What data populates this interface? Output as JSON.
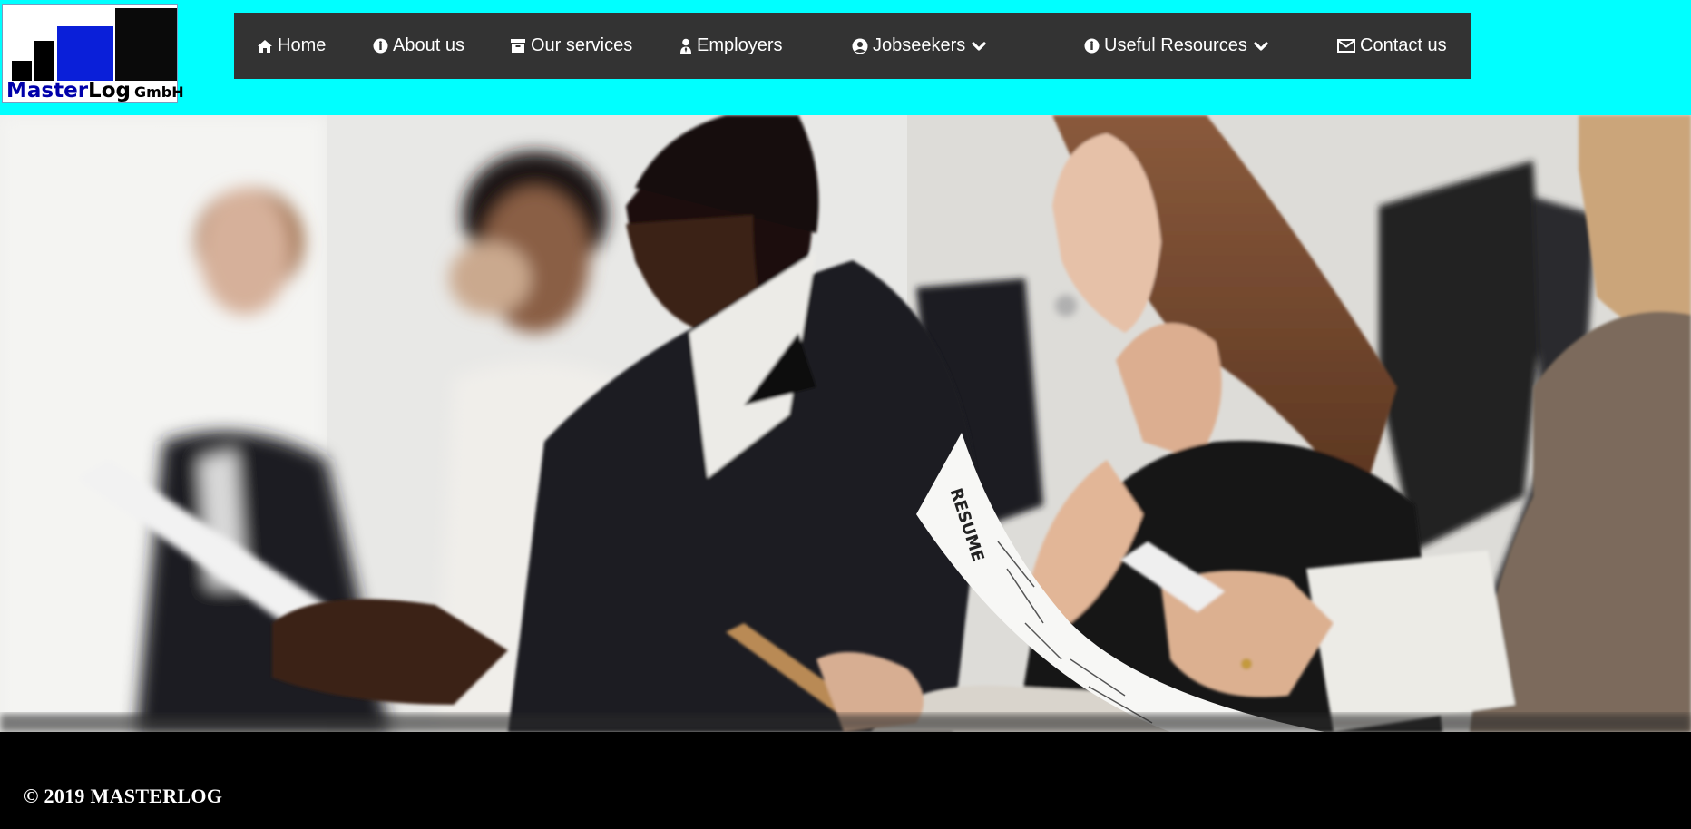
{
  "brand": {
    "name_part1": "Master",
    "name_part2": "Log",
    "suffix": "GmbH",
    "header_bg": "#00ffff",
    "logo_blue": "#0000aa"
  },
  "nav": {
    "bg": "#333333",
    "items": [
      {
        "label": "Home",
        "icon": "home-icon"
      },
      {
        "label": "About us",
        "icon": "info-circle-icon"
      },
      {
        "label": "Our services",
        "icon": "archive-box-icon"
      },
      {
        "label": "Employers",
        "icon": "user-tie-icon"
      },
      {
        "label": "Jobseekers",
        "icon": "user-circle-icon",
        "dropdown": true
      },
      {
        "label": "Useful Resources",
        "icon": "info-circle-icon",
        "dropdown": true
      },
      {
        "label": "Contact us",
        "icon": "envelope-icon"
      }
    ]
  },
  "hero": {
    "alt": "Job candidates waiting in a row of office chairs reading resumes and phones",
    "resume_word": "RESUME"
  },
  "footer": {
    "copyright": "© 2019 MASTERLOG"
  }
}
